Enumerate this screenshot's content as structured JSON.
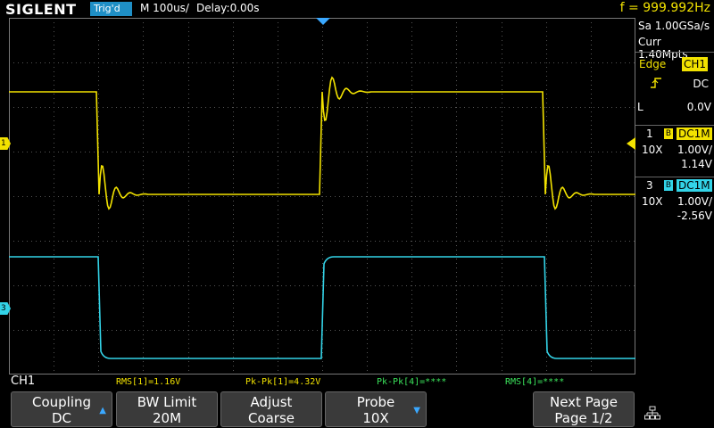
{
  "header": {
    "brand": "SIGLENT",
    "trigger_status": "Trig'd",
    "timebase": "M 100us/",
    "delay": "Delay:0.00s",
    "frequency": "f = 999.992Hz"
  },
  "acquisition": {
    "sample_rate": "Sa 1.00GSa/s",
    "memory": "Curr 1.40Mpts"
  },
  "trigger": {
    "type": "Edge",
    "source": "CH1",
    "slope_icon": "rising-edge-icon",
    "coupling": "DC",
    "level_prefix": "L",
    "level": "0.0V"
  },
  "channels": [
    {
      "num": "1",
      "bw": "B",
      "coupling": "DC1M",
      "probe": "10X",
      "vdiv": "1.00V/",
      "offset": "1.14V",
      "color": "#f2e200"
    },
    {
      "num": "3",
      "bw": "B",
      "coupling": "DC1M",
      "probe": "10X",
      "vdiv": "1.00V/",
      "offset": "-2.56V",
      "color": "#33d4e8"
    }
  ],
  "markers": {
    "ch1": "1",
    "ch3": "3"
  },
  "measurements": {
    "selected_channel": "CH1",
    "items": [
      "RMS[1]=1.16V",
      "Pk-Pk[1]=4.32V",
      "Pk-Pk[4]=****",
      "RMS[4]=****"
    ]
  },
  "softkeys": [
    {
      "line1": "Coupling",
      "line2": "DC",
      "has_arrow": true
    },
    {
      "line1": "BW Limit",
      "line2": "20M",
      "has_arrow": false
    },
    {
      "line1": "Adjust",
      "line2": "Coarse",
      "has_arrow": false
    },
    {
      "line1": "Probe",
      "line2": "10X",
      "has_arrow": true
    },
    {
      "line1": "Next Page",
      "line2": "Page 1/2",
      "has_arrow": false
    }
  ],
  "colors": {
    "ch1": "#f2e200",
    "ch3": "#33d4e8",
    "trig_badge": "#1f8fc6",
    "measure": "#3be35b"
  }
}
